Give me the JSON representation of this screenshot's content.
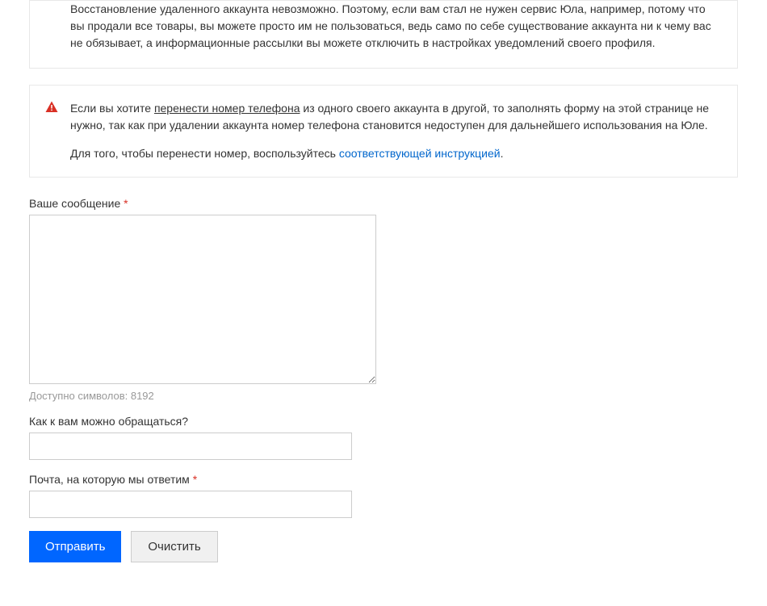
{
  "info": {
    "text": "Восстановление удаленного аккаунта невозможно. Поэтому, если вам стал не нужен сервис Юла, например, потому что вы продали все товары, вы можете просто им не пользоваться, ведь само по себе существование аккаунта ни к чему вас не обязывает, а информационные рассылки вы можете отключить в настройках уведомлений своего профиля."
  },
  "warning": {
    "p1_before": "Если вы хотите ",
    "p1_underlined": "перенести номер телефона",
    "p1_after": " из одного своего аккаунта в другой, то заполнять форму на этой странице не нужно, так как при удалении аккаунта номер телефона становится недоступен для дальнейшего использования на Юле.",
    "p2_before": "Для того, чтобы перенести номер, воспользуйтесь ",
    "p2_link": "соответствующей инструкцией",
    "p2_after": "."
  },
  "form": {
    "message_label": "Ваше сообщение",
    "message_value": "",
    "char_counter_prefix": "Доступно символов: ",
    "char_counter_value": "8192",
    "name_label": "Как к вам можно обращаться?",
    "name_value": "",
    "email_label": "Почта, на которую мы ответим",
    "email_value": "",
    "required_mark": "*",
    "submit_label": "Отправить",
    "clear_label": "Очистить"
  }
}
